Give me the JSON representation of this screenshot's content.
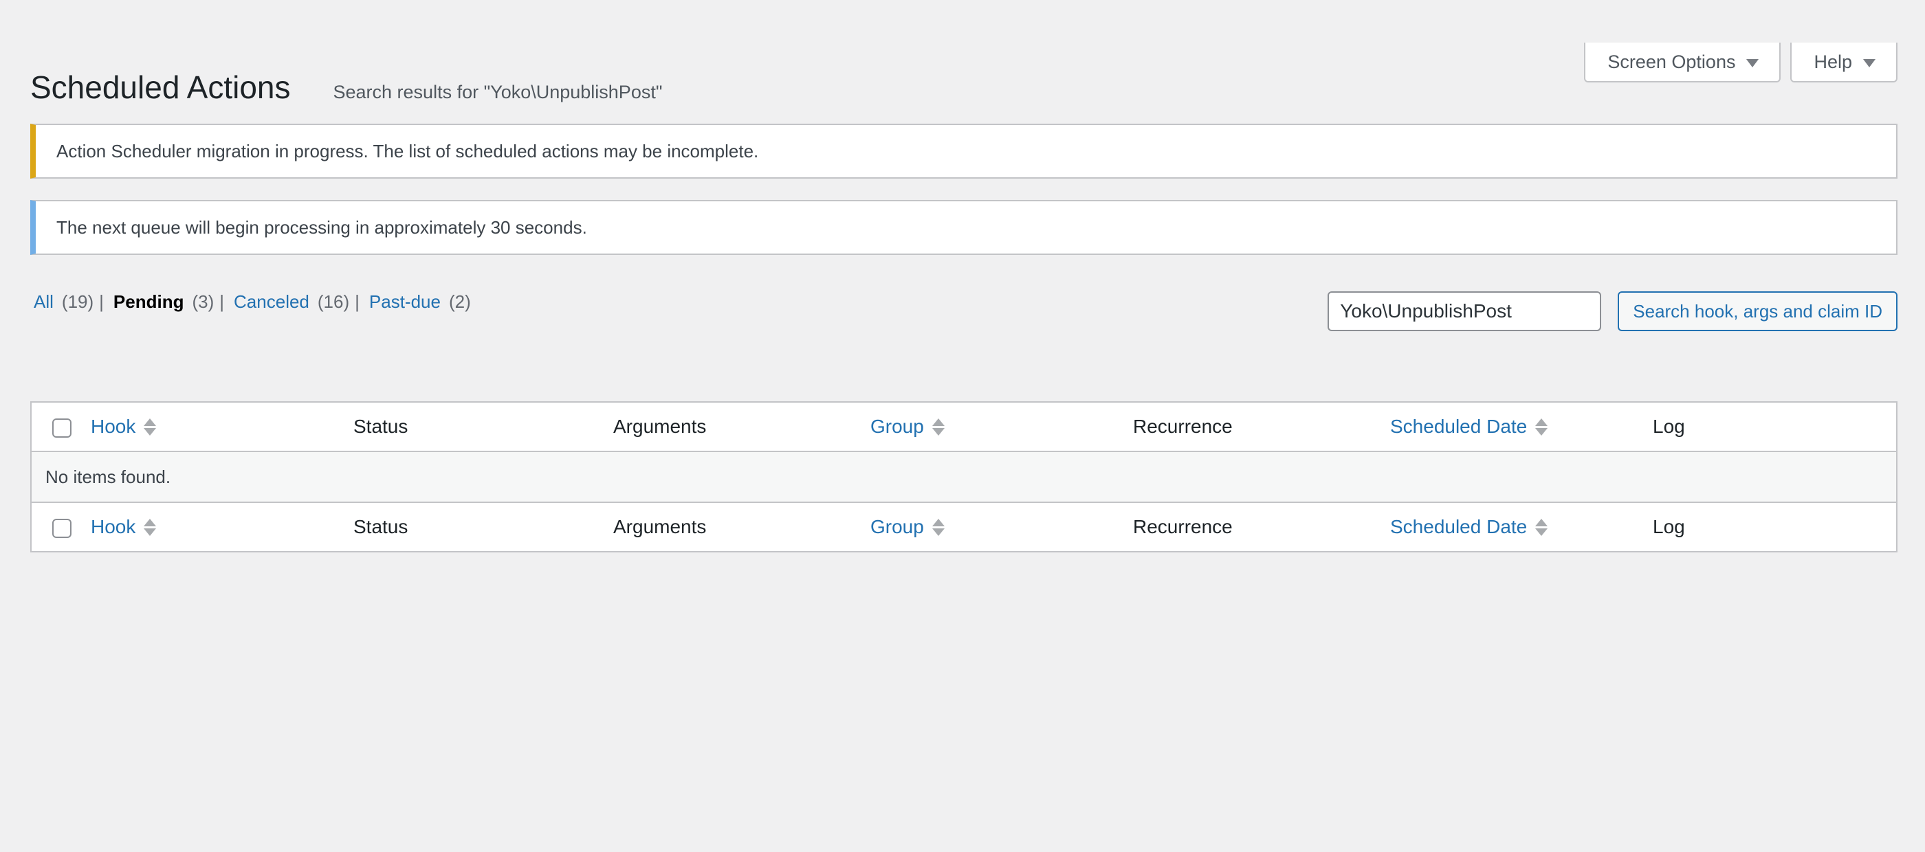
{
  "screen_meta": {
    "screen_options_label": "Screen Options",
    "help_label": "Help"
  },
  "header": {
    "title": "Scheduled Actions",
    "subtitle": "Search results for \"Yoko\\UnpublishPost\""
  },
  "notices": {
    "warning": "Action Scheduler migration in progress. The list of scheduled actions may be incomplete.",
    "info": "The next queue will begin processing in approximately 30 seconds."
  },
  "filters": [
    {
      "label": "All",
      "count": "(19)"
    },
    {
      "label": "Pending",
      "count": "(3)"
    },
    {
      "label": "Canceled",
      "count": "(16)"
    },
    {
      "label": "Past-due",
      "count": "(2)"
    }
  ],
  "search": {
    "value": "Yoko\\UnpublishPost",
    "button_label": "Search hook, args and claim ID"
  },
  "table": {
    "columns": {
      "hook": "Hook",
      "status": "Status",
      "arguments": "Arguments",
      "group": "Group",
      "recurrence": "Recurrence",
      "scheduled_date": "Scheduled Date",
      "log": "Log"
    },
    "empty_message": "No items found."
  },
  "colors": {
    "link": "#2271b1",
    "warning_border": "#dba617",
    "info_border": "#72aee6",
    "background": "#f0f0f1"
  }
}
